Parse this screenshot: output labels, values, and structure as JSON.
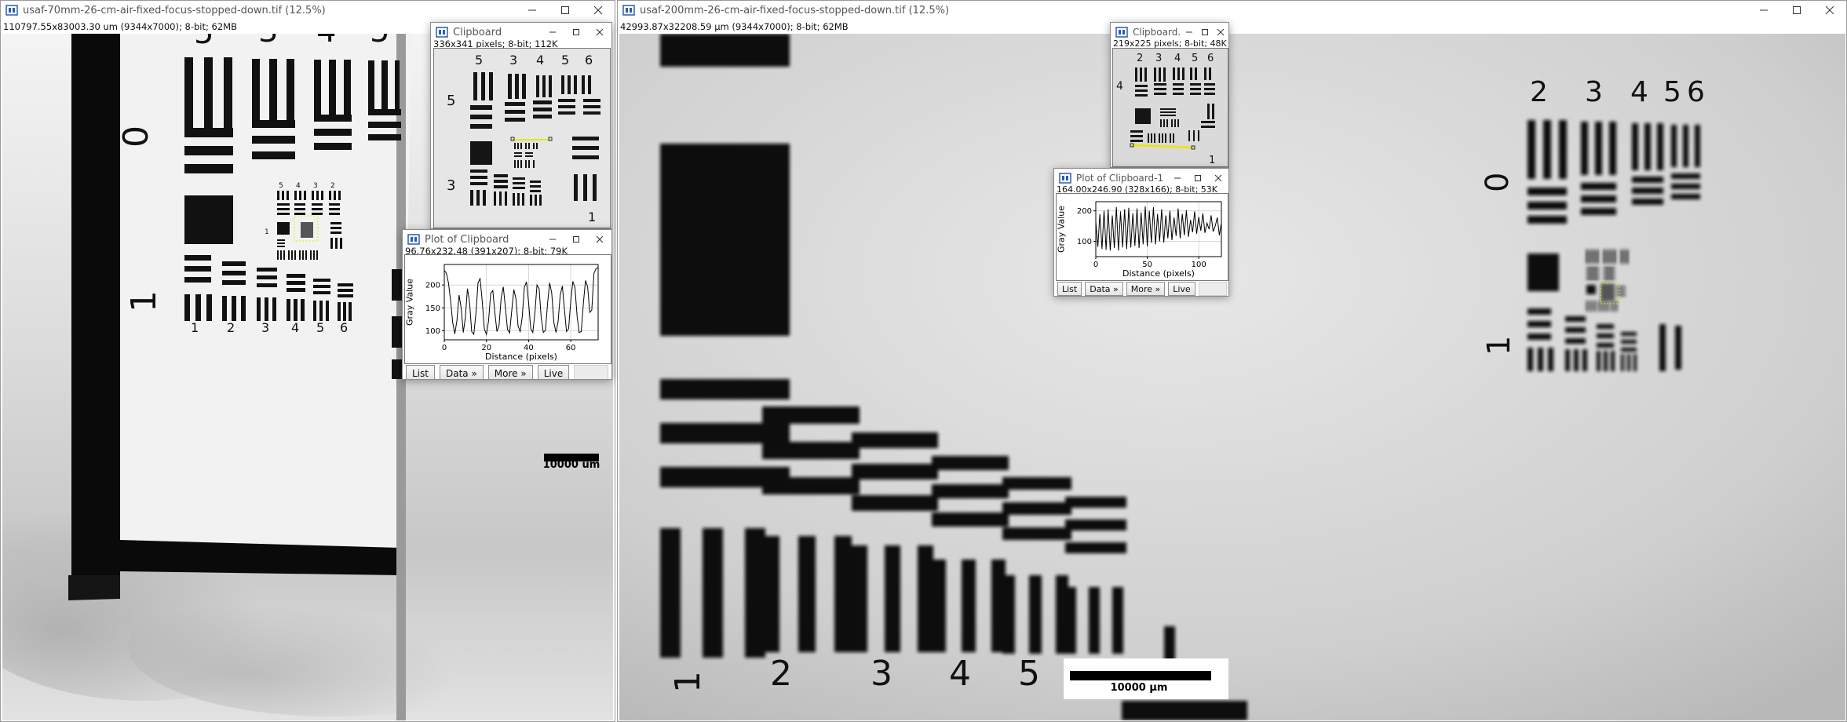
{
  "colors": {
    "accent": "#2b5ea7",
    "selection": "#e8e800",
    "titlebar_text": "#555555"
  },
  "icons": {
    "app": "imagej-window-icon",
    "minimize": "minimize-icon",
    "maximize": "maximize-icon",
    "close": "close-icon"
  },
  "left_window": {
    "title": "usaf-70mm-26-cm-air-fixed-focus-stopped-down.tif (12.5%)",
    "info": "110797.55x83003.30  um (9344x7000); 8-bit; 62MB",
    "scalebar_label": "10000  um",
    "chart_numbers": [
      "5",
      "3",
      "4",
      "5",
      "0",
      "1",
      "1",
      "2",
      "3",
      "4",
      "5",
      "6",
      "1",
      "5",
      "4",
      "3",
      "2"
    ]
  },
  "right_window": {
    "title": "usaf-200mm-26-cm-air-fixed-focus-stopped-down.tif (12.5%)",
    "info": "42993.87x32208.59 µm (9344x7000); 8-bit; 62MB",
    "scalebar_label": "10000 µm",
    "chart_numbers": [
      "2",
      "3",
      "4",
      "5",
      "6",
      "0",
      "1",
      "1",
      "2",
      "3",
      "4",
      "5"
    ]
  },
  "clipboard_window": {
    "title": "Clipboard",
    "info": "336x341 pixels; 8-bit; 112K",
    "chart_numbers": [
      "5",
      "3",
      "4",
      "5",
      "6",
      "5",
      "3",
      "1"
    ]
  },
  "clipboard_small_window": {
    "title": "Clipboard...",
    "info": "219x225 pixels; 8-bit; 48K",
    "chart_numbers": [
      "2",
      "3",
      "4",
      "5",
      "6",
      "4",
      "1"
    ]
  },
  "plot_window": {
    "title": "Plot of Clipboard",
    "info": "96.76x232.48  (391x207); 8-bit; 79K",
    "buttons": {
      "list": "List",
      "data": "Data »",
      "more": "More »",
      "live": "Live"
    },
    "chart_data": {
      "type": "line",
      "xlabel": "Distance (pixels)",
      "ylabel": "Gray Value",
      "xlim": [
        0,
        73
      ],
      "ylim": [
        80,
        245
      ],
      "xticks": [
        0,
        20,
        40,
        60
      ],
      "yticks": [
        100,
        150,
        200
      ],
      "grid": true,
      "x": [
        0,
        1,
        2,
        3,
        4,
        5,
        6,
        7,
        8,
        9,
        10,
        11,
        12,
        13,
        14,
        15,
        16,
        17,
        18,
        19,
        20,
        21,
        22,
        23,
        24,
        25,
        26,
        27,
        28,
        29,
        30,
        31,
        32,
        33,
        34,
        35,
        36,
        37,
        38,
        39,
        40,
        41,
        42,
        43,
        44,
        45,
        46,
        47,
        48,
        49,
        50,
        51,
        52,
        53,
        54,
        55,
        56,
        57,
        58,
        59,
        60,
        61,
        62,
        63,
        64,
        65,
        66,
        67,
        68,
        69,
        70,
        71,
        72,
        73
      ],
      "y": [
        232,
        226,
        204,
        165,
        118,
        93,
        122,
        178,
        150,
        96,
        128,
        192,
        162,
        98,
        92,
        138,
        205,
        214,
        165,
        104,
        92,
        121,
        182,
        188,
        140,
        98,
        112,
        172,
        196,
        150,
        103,
        95,
        143,
        190,
        170,
        110,
        98,
        130,
        195,
        207,
        162,
        105,
        96,
        140,
        200,
        192,
        128,
        96,
        101,
        160,
        205,
        182,
        118,
        96,
        120,
        178,
        198,
        148,
        98,
        104,
        165,
        208,
        194,
        132,
        96,
        98,
        160,
        210,
        196,
        140,
        145,
        225,
        236,
        238
      ]
    }
  },
  "plot1_window": {
    "title": "Plot of Clipboard-1",
    "info": "164.00x246.90   (328x166); 8-bit; 53K",
    "buttons": {
      "list": "List",
      "data": "Data »",
      "more": "More »",
      "live": "Live"
    },
    "chart_data": {
      "type": "line",
      "xlabel": "Distance (pixels)",
      "ylabel": "Gray Value",
      "xlim": [
        0,
        122
      ],
      "ylim": [
        50,
        230
      ],
      "xticks": [
        0,
        50,
        100
      ],
      "yticks": [
        100,
        200
      ],
      "grid": true,
      "x": [
        0,
        2,
        4,
        6,
        8,
        10,
        12,
        14,
        16,
        18,
        20,
        22,
        24,
        26,
        28,
        30,
        32,
        34,
        36,
        38,
        40,
        42,
        44,
        46,
        48,
        50,
        52,
        54,
        56,
        58,
        60,
        62,
        64,
        66,
        68,
        70,
        72,
        74,
        76,
        78,
        80,
        82,
        84,
        86,
        88,
        90,
        92,
        94,
        96,
        98,
        100,
        102,
        104,
        106,
        108,
        110,
        112,
        114,
        116,
        118,
        120,
        122
      ],
      "y": [
        165,
        82,
        190,
        75,
        200,
        72,
        205,
        70,
        185,
        78,
        212,
        70,
        198,
        80,
        205,
        75,
        210,
        80,
        192,
        85,
        208,
        78,
        195,
        90,
        215,
        84,
        200,
        95,
        212,
        90,
        190,
        100,
        205,
        96,
        185,
        110,
        200,
        104,
        178,
        118,
        208,
        110,
        190,
        120,
        202,
        115,
        170,
        130,
        198,
        125,
        180,
        135,
        192,
        128,
        160,
        140,
        185,
        132,
        150,
        178,
        120,
        160
      ]
    }
  }
}
